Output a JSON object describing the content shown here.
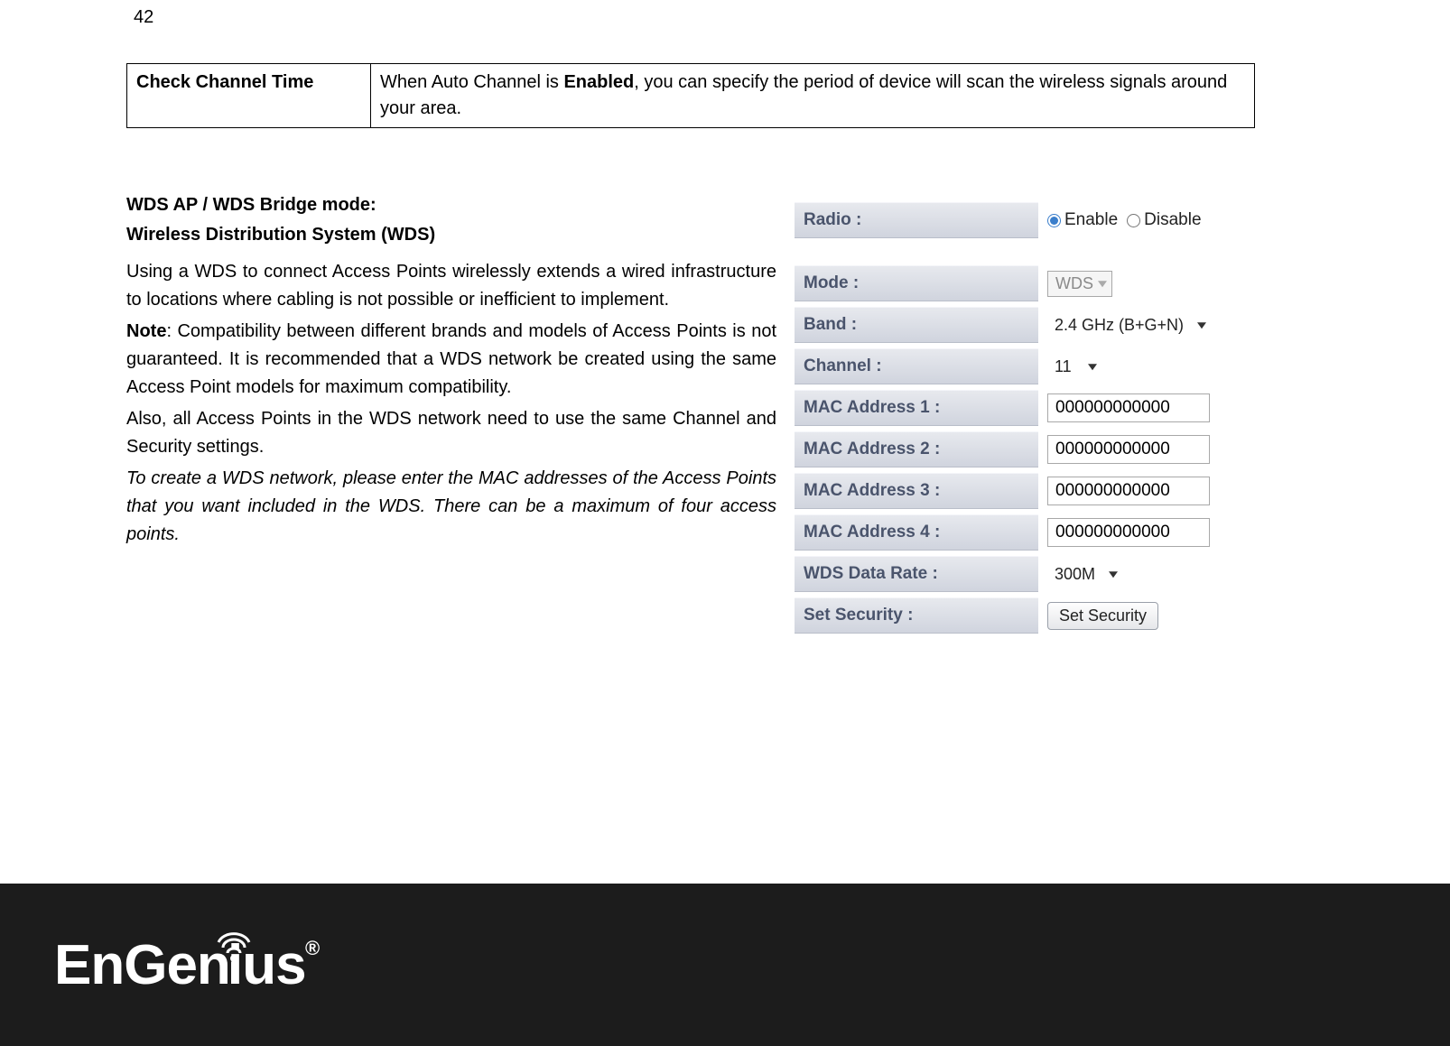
{
  "page_number": "42",
  "table": {
    "label": "Check Channel Time",
    "desc_pre": "When Auto Channel is ",
    "desc_bold": "Enabled",
    "desc_post": ", you can specify the period of device will scan the wireless signals around your area."
  },
  "wds": {
    "heading1": "WDS AP / WDS Bridge mode:",
    "heading2": "Wireless Distribution System (WDS)",
    "p1": "Using a WDS to connect Access Points wirelessly extends a wired infrastructure to locations where cabling is not possible or inefficient to implement.",
    "note_label": "Note",
    "p2": ": Compatibility between different brands and models of Access Points is not guaranteed. It is recommended that a WDS network be created using the same Access Point models for maximum compatibility.",
    "p3": "Also, all Access Points in the WDS network need to use the same Channel and Security settings.",
    "p4": "To create a WDS network, please enter the MAC addresses of the Access Points that you want included in the WDS. There can be a maximum of four access points."
  },
  "panel": {
    "radio_label": "Radio :",
    "radio_enable": "Enable",
    "radio_disable": "Disable",
    "mode_label": "Mode :",
    "mode_value": "WDS",
    "band_label": "Band :",
    "band_value": "2.4 GHz (B+G+N)",
    "channel_label": "Channel :",
    "channel_value": "11",
    "mac1_label": "MAC Address 1 :",
    "mac1_value": "000000000000",
    "mac2_label": "MAC Address 2 :",
    "mac2_value": "000000000000",
    "mac3_label": "MAC Address 3 :",
    "mac3_value": "000000000000",
    "mac4_label": "MAC Address 4 :",
    "mac4_value": "000000000000",
    "rate_label": "WDS Data Rate :",
    "rate_value": "300M",
    "security_label": "Set Security :",
    "security_button": "Set Security"
  },
  "logo": {
    "text": "EnGenius"
  }
}
